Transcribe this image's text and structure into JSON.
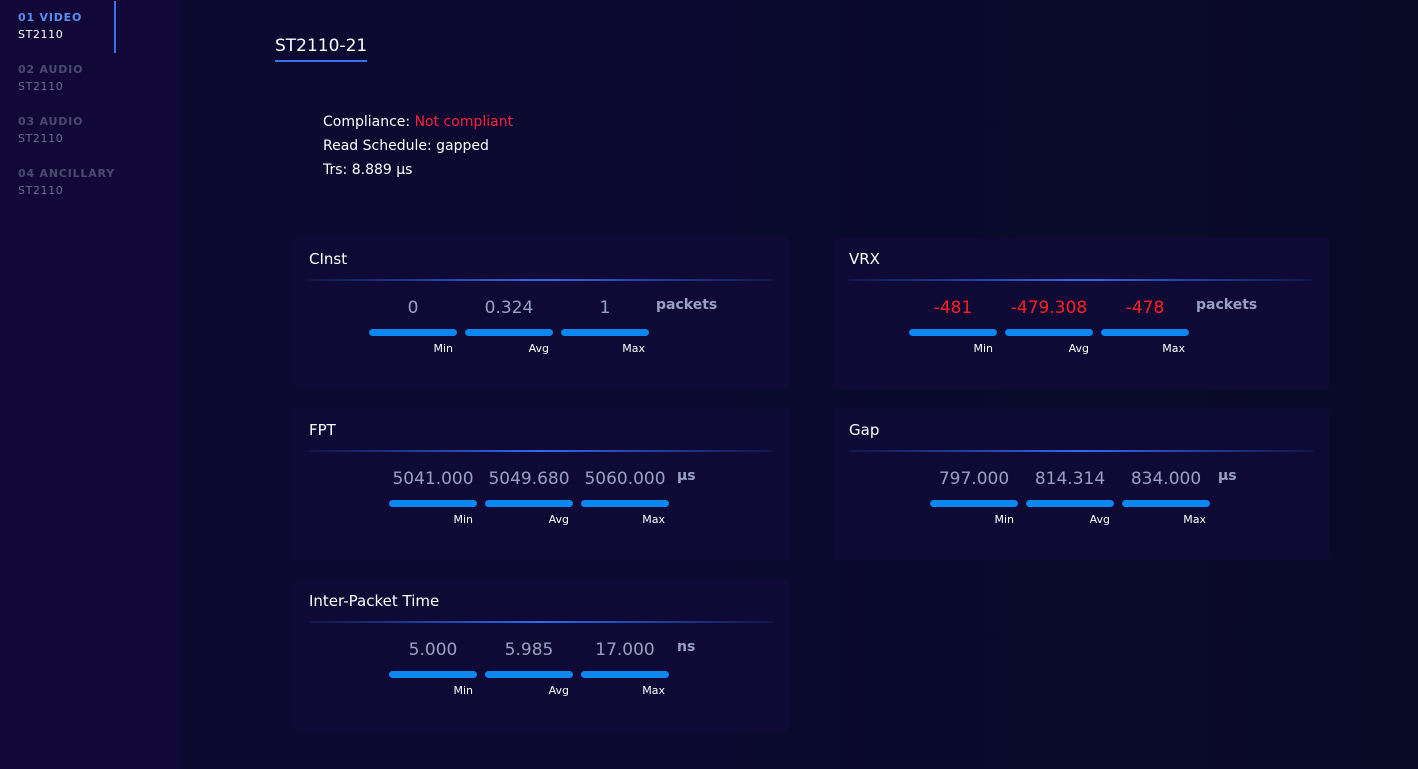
{
  "sidebar": {
    "items": [
      {
        "number_label": "01 VIDEO",
        "type": "ST2110"
      },
      {
        "number_label": "02 AUDIO",
        "type": "ST2110"
      },
      {
        "number_label": "03 AUDIO",
        "type": "ST2110"
      },
      {
        "number_label": "04 ANCILLARY",
        "type": "ST2110"
      }
    ]
  },
  "header": {
    "tab_label": "ST2110-21"
  },
  "info": {
    "compliance_label": "Compliance:",
    "compliance_value": "Not compliant",
    "schedule_label": "Read Schedule:",
    "schedule_value": "gapped",
    "trs_label": "Trs:",
    "trs_value": "8.889 µs"
  },
  "stat_labels": {
    "min": "Min",
    "avg": "Avg",
    "max": "Max"
  },
  "cards": {
    "cinst": {
      "title": "CInst",
      "min": "0",
      "avg": "0.324",
      "max": "1",
      "unit": "packets"
    },
    "vrx": {
      "title": "VRX",
      "min": "-481",
      "avg": "-479.308",
      "max": "-478",
      "unit": "packets"
    },
    "fpt": {
      "title": "FPT",
      "min": "5041.000",
      "avg": "5049.680",
      "max": "5060.000",
      "unit": "µs"
    },
    "gap": {
      "title": "Gap",
      "min": "797.000",
      "avg": "814.314",
      "max": "834.000",
      "unit": "µs"
    },
    "ipt": {
      "title": "Inter-Packet Time",
      "min": "5.000",
      "avg": "5.985",
      "max": "17.000",
      "unit": "ns"
    }
  },
  "colors": {
    "accent": "#3a6ff0",
    "bar": "#0c86f0",
    "error": "#ff1e3c",
    "background": "#0c0a2c"
  }
}
